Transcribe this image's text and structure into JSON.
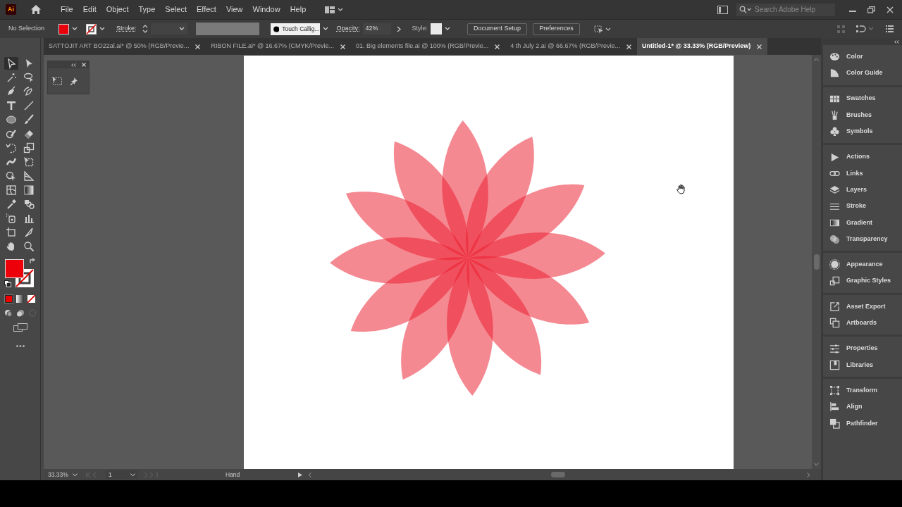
{
  "app_logo": "Ai",
  "menu": [
    "File",
    "Edit",
    "Object",
    "Type",
    "Select",
    "Effect",
    "View",
    "Window",
    "Help"
  ],
  "search": {
    "placeholder": "Search Adobe Help"
  },
  "control_bar": {
    "selection": "No Selection",
    "stroke_label": "Stroke:",
    "brush": "Touch Callig...",
    "opacity_label": "Opacity:",
    "opacity": "42%",
    "style_label": "Style:",
    "buttons": [
      "Document Setup",
      "Preferences"
    ]
  },
  "tabs": [
    {
      "label": "SATTOJIT ART BO22al.ai* @ 50% (RGB/Previe...",
      "selected": false
    },
    {
      "label": "RIBON FILE.ai* @ 16.67% (CMYK/Previe...",
      "selected": false
    },
    {
      "label": "01. Big elements file.ai @ 100% (RGB/Previe...",
      "selected": false
    },
    {
      "label": "4 th July 2.ai @ 66.67% (RGB/Previe...",
      "selected": false
    },
    {
      "label": "Untitled-1* @ 33.33% (RGB/Preview)",
      "selected": true
    }
  ],
  "tools": [
    {
      "selected": true
    },
    {
      "selected": false
    },
    {
      "selected": false
    },
    {
      "selected": false
    },
    {
      "selected": false
    },
    {
      "selected": false
    },
    {
      "selected": false
    },
    {
      "selected": false
    },
    {
      "selected": false
    },
    {
      "selected": false
    },
    {
      "selected": false
    },
    {
      "selected": false
    },
    {
      "selected": false
    },
    {
      "selected": false
    },
    {
      "selected": false
    },
    {
      "selected": false
    },
    {
      "selected": false
    },
    {
      "selected": false
    },
    {
      "selected": false
    },
    {
      "selected": false
    },
    {
      "selected": false
    },
    {
      "selected": false
    },
    {
      "selected": false
    },
    {
      "selected": false
    },
    {
      "selected": false
    },
    {
      "selected": false
    },
    {
      "selected": false
    },
    {
      "selected": false
    }
  ],
  "panels": [
    {
      "items": [
        "Color",
        "Color Guide"
      ]
    },
    {
      "items": [
        "Swatches",
        "Brushes",
        "Symbols"
      ]
    },
    {
      "items": [
        "Actions",
        "Links",
        "Layers",
        "Stroke",
        "Gradient",
        "Transparency"
      ]
    },
    {
      "items": [
        "Appearance",
        "Graphic Styles"
      ]
    },
    {
      "items": [
        "Asset Export",
        "Artboards"
      ]
    },
    {
      "items": [
        "Properties",
        "Libraries"
      ]
    },
    {
      "items": [
        "Transform",
        "Align",
        "Pathfinder"
      ]
    }
  ],
  "status_bar": {
    "zoom": "33.33%",
    "artboard": "1",
    "tool": "Hand"
  }
}
